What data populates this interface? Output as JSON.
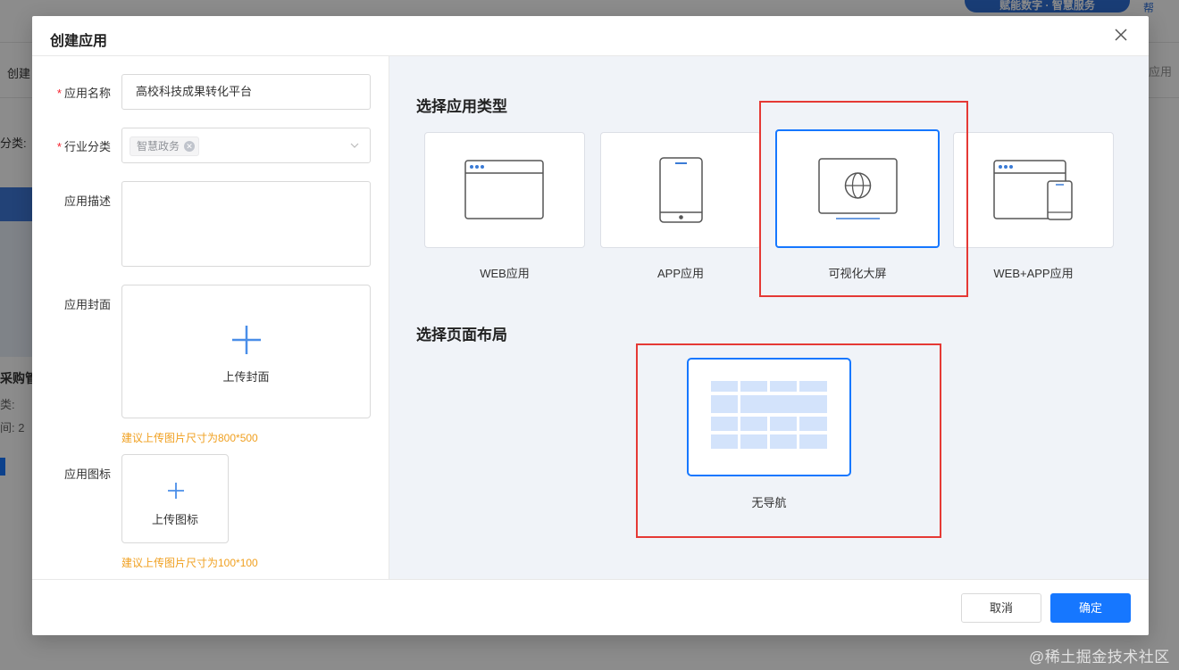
{
  "background": {
    "banner_text": "赋能数字 · 智慧服务",
    "top_right_text": "帮",
    "tab_label": "创建",
    "right_tab_label": "应用",
    "category_label": "分类:",
    "card_title": "采购管",
    "card_line1": "类:",
    "card_line2": "间: 2",
    "watermark": "@稀土掘金技术社区"
  },
  "modal": {
    "title": "创建应用",
    "close_icon": "close-icon"
  },
  "form": {
    "name_label": "应用名称",
    "name_value": "高校科技成果转化平台",
    "industry_label": "行业分类",
    "industry_tag": "智慧政务",
    "desc_label": "应用描述",
    "cover_label": "应用封面",
    "cover_upload_text": "上传封面",
    "cover_hint": "建议上传图片尺寸为800*500",
    "icon_label": "应用图标",
    "icon_upload_text": "上传图标",
    "icon_hint": "建议上传图片尺寸为100*100"
  },
  "app_types": {
    "section_title": "选择应用类型",
    "items": [
      {
        "label": "WEB应用",
        "icon": "browser-window-icon"
      },
      {
        "label": "APP应用",
        "icon": "mobile-phone-icon"
      },
      {
        "label": "可视化大屏",
        "icon": "globe-screen-icon"
      },
      {
        "label": "WEB+APP应用",
        "icon": "browser-mobile-icon"
      }
    ],
    "selected_index": 2
  },
  "page_layout": {
    "section_title": "选择页面布局",
    "option_label": "无导航"
  },
  "footer": {
    "cancel_label": "取消",
    "ok_label": "确定"
  },
  "colors": {
    "primary": "#1677ff",
    "highlight_box": "#e53935",
    "hint": "#f0a020",
    "required": "#f5222d"
  }
}
